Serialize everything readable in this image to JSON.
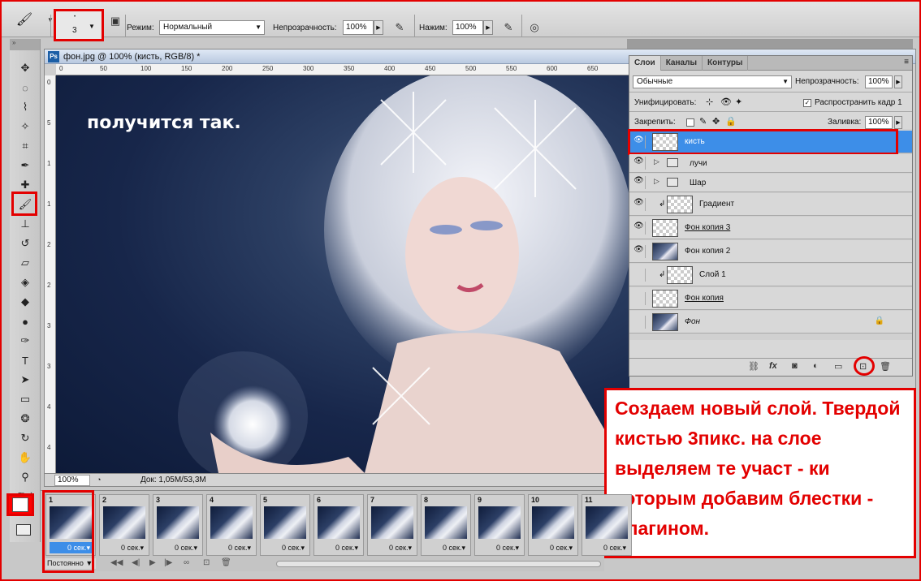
{
  "optionsbar": {
    "brush_size": "3",
    "mode_label": "Режим:",
    "mode_value": "Нормальный",
    "opacity_label": "Непрозрачность:",
    "opacity_value": "100%",
    "flow_label": "Нажим:",
    "flow_value": "100%"
  },
  "document": {
    "title": "фон.jpg @ 100% (кисть, RGB/8) *",
    "canvas_caption": "получится так.",
    "zoom": "100%",
    "doc_info": "Док: 1,05M/53,3M",
    "ruler_h": [
      "0",
      "50",
      "100",
      "150",
      "200",
      "250",
      "300",
      "350",
      "400",
      "450",
      "500",
      "550",
      "600",
      "650"
    ],
    "ruler_v": [
      "0",
      "5",
      "1",
      "1",
      "2",
      "2",
      "3",
      "3",
      "4",
      "4"
    ]
  },
  "layers_panel": {
    "tabs": [
      "Слои",
      "Каналы",
      "Контуры"
    ],
    "blend_mode": "Обычные",
    "opacity_label": "Непрозрачность:",
    "opacity_value": "100%",
    "unify_label": "Унифицировать:",
    "propagate_label": "Распространить кадр 1",
    "lock_label": "Закрепить:",
    "fill_label": "Заливка:",
    "fill_value": "100%",
    "layers": [
      {
        "name": "кисть",
        "visible": true,
        "selected": true,
        "type": "transparent"
      },
      {
        "name": "лучи",
        "visible": true,
        "type": "group"
      },
      {
        "name": "Шар",
        "visible": true,
        "type": "group"
      },
      {
        "name": "Градиент",
        "visible": true,
        "type": "clipped"
      },
      {
        "name": "Фон копия 3",
        "visible": true,
        "type": "transparent",
        "underline": true
      },
      {
        "name": "Фон копия 2",
        "visible": true,
        "type": "photo"
      },
      {
        "name": "Слой 1",
        "visible": false,
        "type": "clipped"
      },
      {
        "name": "Фон копия",
        "visible": false,
        "type": "transparent",
        "underline": true
      },
      {
        "name": "Фон",
        "visible": false,
        "type": "photo",
        "italic": true,
        "locked": true
      }
    ]
  },
  "note": {
    "text": "Создаем новый слой. Твердой кистью 3пикс. на слое выделяем те участ - ки которым добавим блестки - плагином."
  },
  "timeline": {
    "frames": [
      {
        "num": "1",
        "delay": "0 сек.",
        "active": true
      },
      {
        "num": "2",
        "delay": "0 сек."
      },
      {
        "num": "3",
        "delay": "0 сек."
      },
      {
        "num": "4",
        "delay": "0 сек."
      },
      {
        "num": "5",
        "delay": "0 сек."
      },
      {
        "num": "6",
        "delay": "0 сек."
      },
      {
        "num": "7",
        "delay": "0 сек."
      },
      {
        "num": "8",
        "delay": "0 сек."
      },
      {
        "num": "9",
        "delay": "0 сек."
      },
      {
        "num": "10",
        "delay": "0 сек."
      },
      {
        "num": "11",
        "delay": "0 сек."
      }
    ],
    "loop": "Постоянно"
  },
  "colors": {
    "highlight_red": "#e30000",
    "selection_blue": "#3d8ee8",
    "foreground": "#ffffff",
    "background": "#ff0000"
  }
}
